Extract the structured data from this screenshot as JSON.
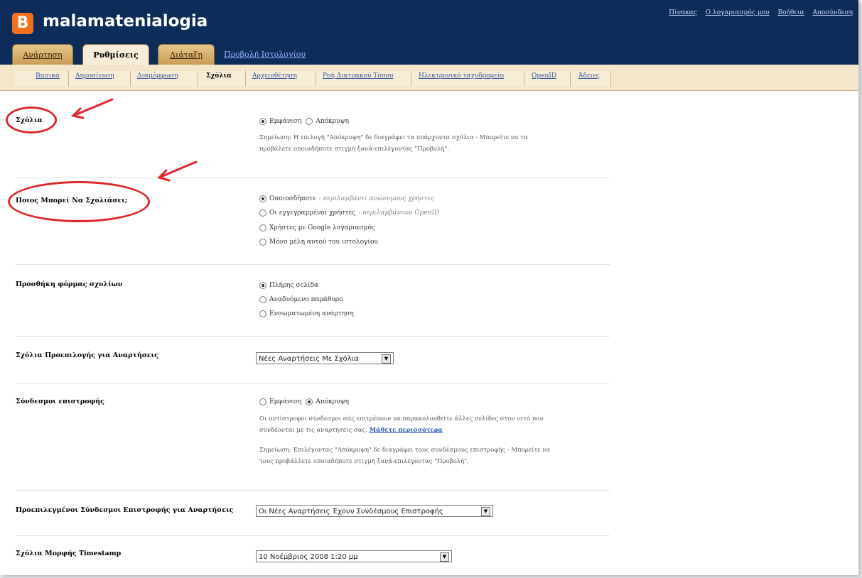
{
  "blog": {
    "title": "malamatenialogia",
    "logo_letter": "B"
  },
  "top_links": [
    "Πίνακας",
    "Ο λογαριασμός μου",
    "Βοήθεια",
    "Αποσύνδεση"
  ],
  "tabs": [
    {
      "label": "Ανάρτηση",
      "active": false
    },
    {
      "label": "Ρυθμίσεις",
      "active": true
    },
    {
      "label": "Διάταξη",
      "active": false
    }
  ],
  "view_blog": "Προβολή Ιστολογίου",
  "subnav": [
    {
      "label": "Βασικά",
      "active": false
    },
    {
      "label": "Δημοσίευση",
      "active": false
    },
    {
      "label": "Διαμόρφωση",
      "active": false
    },
    {
      "label": "Σχόλια",
      "active": true
    },
    {
      "label": "Αρχειοθέτηση",
      "active": false
    },
    {
      "label": "Ροή Δικτυακού Τόπου",
      "active": false
    },
    {
      "label": "Ηλεκτρονικό ταχυδρομείο",
      "active": false
    },
    {
      "label": "OpenID",
      "active": false
    },
    {
      "label": "Άδειες",
      "active": false
    }
  ],
  "comments": {
    "label": "Σχόλια",
    "options": [
      "Εμφάνιση",
      "Απόκρυψη"
    ],
    "selected": 0,
    "note": "Σημείωση: Η επιλογή \"Απόκρυψη\" δε διαγράφει τα υπάρχοντα σχόλια - Μπορείτε να τα προβάλετε οποιαδήποτε στιγμή ξανά-επιλέγοντας \"Προβολή\"."
  },
  "who_can_comment": {
    "label": "Ποιος Μπορεί Να Σχολιάσει;",
    "options": [
      {
        "text": "Οποιοσδήποτε",
        "hint": "- περιλαμβάνει ανώνυμους χρήστες"
      },
      {
        "text": "Οι εγγεγραμμένοι χρήστες",
        "hint": "- περιλαμβάνουν OpenID"
      },
      {
        "text": "Χρήστες με Google λογαριασμός",
        "hint": ""
      },
      {
        "text": "Μόνο μέλη αυτού του ιστολογίου",
        "hint": ""
      }
    ],
    "selected": 0
  },
  "comment_form": {
    "label": "Προσθήκη φόρμας σχολίων",
    "options": [
      "Πλήρης σελίδα",
      "Αναδυόμενο παράθυρο",
      "Ενσωματωμένη ανάρτηση"
    ],
    "selected": 0
  },
  "default_for_posts": {
    "label": "Σχόλια Προεπιλογής για Αναρτήσεις",
    "value": "Νέες Αναρτήσεις Με Σχόλια"
  },
  "backlinks": {
    "label": "Σύνδεσμοι επιστροφής",
    "options": [
      "Εμφάνιση",
      "Απόκρυψη"
    ],
    "selected": 1,
    "note1": "Οι αντίστροφοι σύνδεσμοι σάς επιτρέπουν να παρακολουθείτε άλλες σελίδες στον ιστό που συνδέονται με τις αναρτήσεις σας.",
    "learn_more": "Μάθετε περισσότερα",
    "note2": "Σημείωση: Επιλέγοντας \"Απόκρυψη\" δε διαγράφει τους συνδέσμους επιστροφής - Μπορείτε να τους προβάλλετε οποιαδήποτε στιγμή ξανά-επιλέγοντας \"Προβολή\"."
  },
  "default_backlinks": {
    "label": "Προεπιλεγμένοι Σύνδεσμοι Επιστροφής για Αναρτήσεις",
    "value": "Οι Νέες Αναρτήσεις Έχουν Συνδέσμους Επιστροφής"
  },
  "timestamp_format": {
    "label": "Σχόλια Μορφής Timestamp",
    "value": "10 Νοέμβριος 2008 1:20 μμ"
  },
  "annotation_color": "#e0262a"
}
